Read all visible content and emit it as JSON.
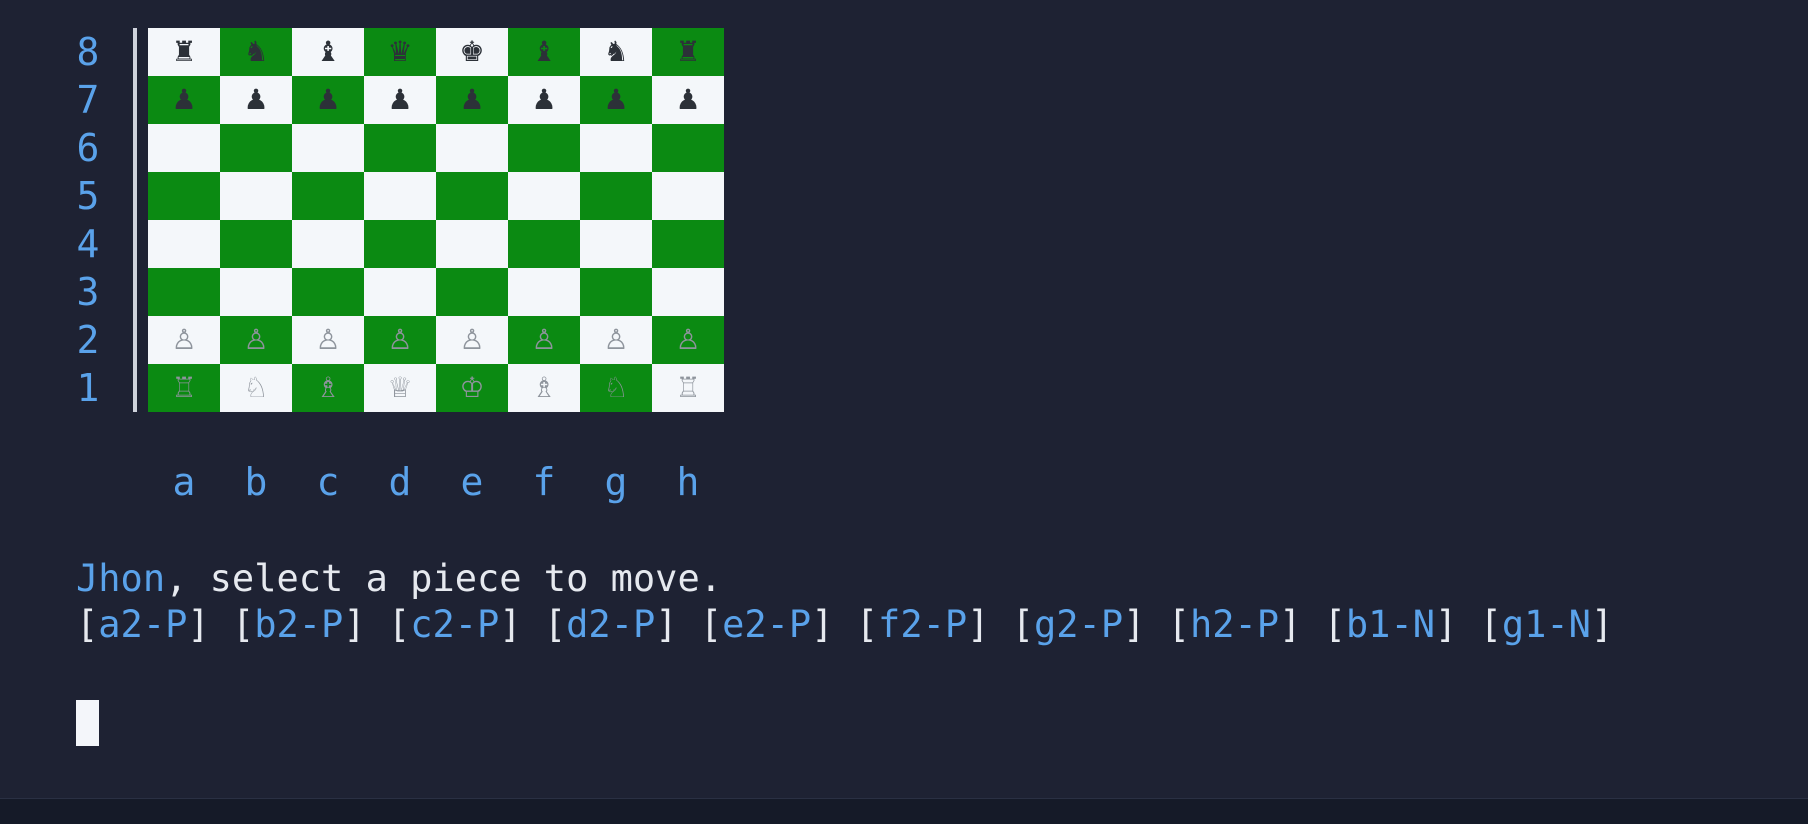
{
  "ranks": [
    "8",
    "7",
    "6",
    "5",
    "4",
    "3",
    "2",
    "1"
  ],
  "files": [
    "a",
    "b",
    "c",
    "d",
    "e",
    "f",
    "g",
    "h"
  ],
  "board": [
    [
      {
        "glyph": "♜",
        "side": "black",
        "piece": "rook"
      },
      {
        "glyph": "♞",
        "side": "black",
        "piece": "knight"
      },
      {
        "glyph": "♝",
        "side": "black",
        "piece": "bishop"
      },
      {
        "glyph": "♛",
        "side": "black",
        "piece": "queen"
      },
      {
        "glyph": "♚",
        "side": "black",
        "piece": "king"
      },
      {
        "glyph": "♝",
        "side": "black",
        "piece": "bishop"
      },
      {
        "glyph": "♞",
        "side": "black",
        "piece": "knight"
      },
      {
        "glyph": "♜",
        "side": "black",
        "piece": "rook"
      }
    ],
    [
      {
        "glyph": "♟",
        "side": "black",
        "piece": "pawn"
      },
      {
        "glyph": "♟",
        "side": "black",
        "piece": "pawn"
      },
      {
        "glyph": "♟",
        "side": "black",
        "piece": "pawn"
      },
      {
        "glyph": "♟",
        "side": "black",
        "piece": "pawn"
      },
      {
        "glyph": "♟",
        "side": "black",
        "piece": "pawn"
      },
      {
        "glyph": "♟",
        "side": "black",
        "piece": "pawn"
      },
      {
        "glyph": "♟",
        "side": "black",
        "piece": "pawn"
      },
      {
        "glyph": "♟",
        "side": "black",
        "piece": "pawn"
      }
    ],
    [
      null,
      null,
      null,
      null,
      null,
      null,
      null,
      null
    ],
    [
      null,
      null,
      null,
      null,
      null,
      null,
      null,
      null
    ],
    [
      null,
      null,
      null,
      null,
      null,
      null,
      null,
      null
    ],
    [
      null,
      null,
      null,
      null,
      null,
      null,
      null,
      null
    ],
    [
      {
        "glyph": "♙",
        "side": "white",
        "piece": "pawn"
      },
      {
        "glyph": "♙",
        "side": "white",
        "piece": "pawn"
      },
      {
        "glyph": "♙",
        "side": "white",
        "piece": "pawn"
      },
      {
        "glyph": "♙",
        "side": "white",
        "piece": "pawn"
      },
      {
        "glyph": "♙",
        "side": "white",
        "piece": "pawn"
      },
      {
        "glyph": "♙",
        "side": "white",
        "piece": "pawn"
      },
      {
        "glyph": "♙",
        "side": "white",
        "piece": "pawn"
      },
      {
        "glyph": "♙",
        "side": "white",
        "piece": "pawn"
      }
    ],
    [
      {
        "glyph": "♖",
        "side": "white",
        "piece": "rook"
      },
      {
        "glyph": "♘",
        "side": "white",
        "piece": "knight"
      },
      {
        "glyph": "♗",
        "side": "white",
        "piece": "bishop"
      },
      {
        "glyph": "♕",
        "side": "white",
        "piece": "queen"
      },
      {
        "glyph": "♔",
        "side": "white",
        "piece": "king"
      },
      {
        "glyph": "♗",
        "side": "white",
        "piece": "bishop"
      },
      {
        "glyph": "♘",
        "side": "white",
        "piece": "knight"
      },
      {
        "glyph": "♖",
        "side": "white",
        "piece": "rook"
      }
    ]
  ],
  "colors": {
    "background": "#1e2233",
    "accent": "#5aa2ea",
    "light_square": "#f4f7fa",
    "dark_square": "#0b8a12",
    "text": "#e6e9ef"
  },
  "prompt": {
    "player": "Jhon",
    "text": ", select a piece to move."
  },
  "options": [
    "a2-P",
    "b2-P",
    "c2-P",
    "d2-P",
    "e2-P",
    "f2-P",
    "g2-P",
    "h2-P",
    "b1-N",
    "g1-N"
  ]
}
